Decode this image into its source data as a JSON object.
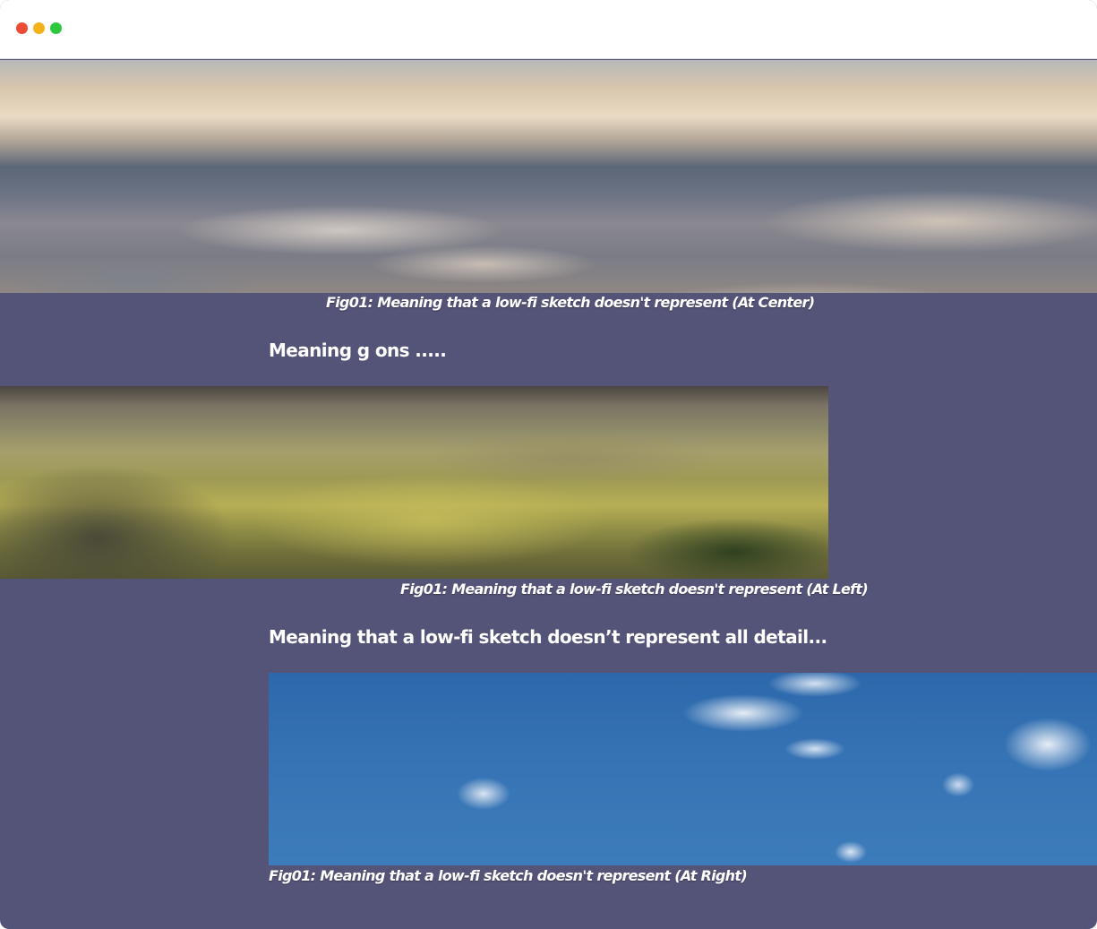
{
  "window": {
    "controls": [
      "close",
      "minimize",
      "zoom"
    ]
  },
  "figures": [
    {
      "image": "clouds-sea-photo",
      "caption": "Fig01: Meaning that a low-fi sketch doesn't represent (At Center)"
    },
    {
      "image": "mountain-valley-photo",
      "caption": "Fig01: Meaning that a low-fi sketch doesn't represent (At Left)"
    },
    {
      "image": "blue-sky-clouds-photo",
      "caption": "Fig01: Meaning that a low-fi sketch doesn't represent (At Right)"
    }
  ],
  "headings": [
    "Meaning g ons .....",
    "Meaning that a low-fi sketch doesn’t represent all detail..."
  ],
  "colors": {
    "page_background": "#545378",
    "text": "#ffffff",
    "close_button": "#ed4b36",
    "minimize_button": "#f4b21a",
    "zoom_button": "#2dc83c"
  }
}
